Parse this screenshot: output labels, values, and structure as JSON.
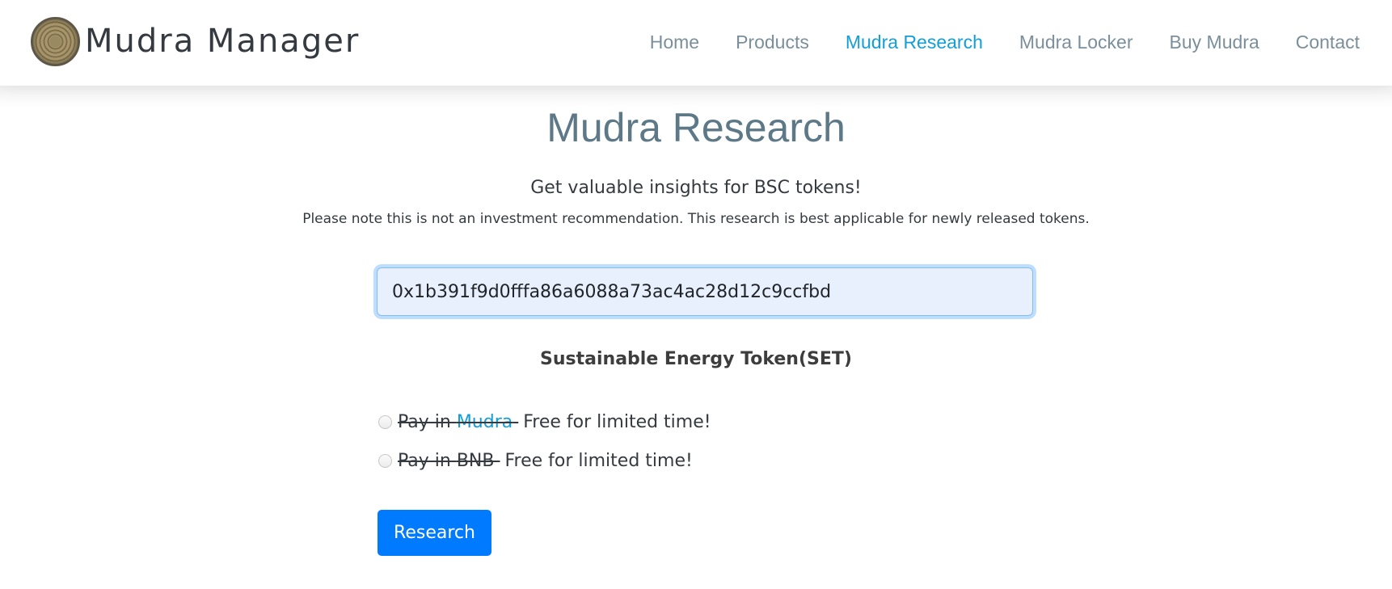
{
  "header": {
    "brand_name": "Mudra Manager",
    "logo_icon": "coin-logo-icon",
    "nav": [
      {
        "label": "Home",
        "active": false
      },
      {
        "label": "Products",
        "active": false
      },
      {
        "label": "Mudra Research",
        "active": true
      },
      {
        "label": "Mudra Locker",
        "active": false
      },
      {
        "label": "Buy Mudra",
        "active": false
      },
      {
        "label": "Contact",
        "active": false
      }
    ]
  },
  "main": {
    "title": "Mudra Research",
    "subtitle": "Get valuable insights for BSC tokens!",
    "note": "Please note this is not an investment recommendation. This research is best applicable for newly released tokens.",
    "address_input": {
      "value": "0x1b391f9d0fffa86a6088a73ac4ac28d12c9ccfbd",
      "placeholder": ""
    },
    "token_name": "Sustainable Energy Token(SET)",
    "payment_options": [
      {
        "prefix": "Pay in ",
        "currency": "Mudra",
        "currency_is_link": true,
        "suffix": "Free for limited time!",
        "checked": false
      },
      {
        "prefix": "Pay in ",
        "currency": "BNB",
        "currency_is_link": false,
        "suffix": "Free for limited time!",
        "checked": false
      }
    ],
    "research_button_label": "Research"
  },
  "colors": {
    "accent": "#139ed8",
    "nav_text": "#7b8f9b",
    "title_text": "#5d7887",
    "button_primary": "#007bff"
  }
}
